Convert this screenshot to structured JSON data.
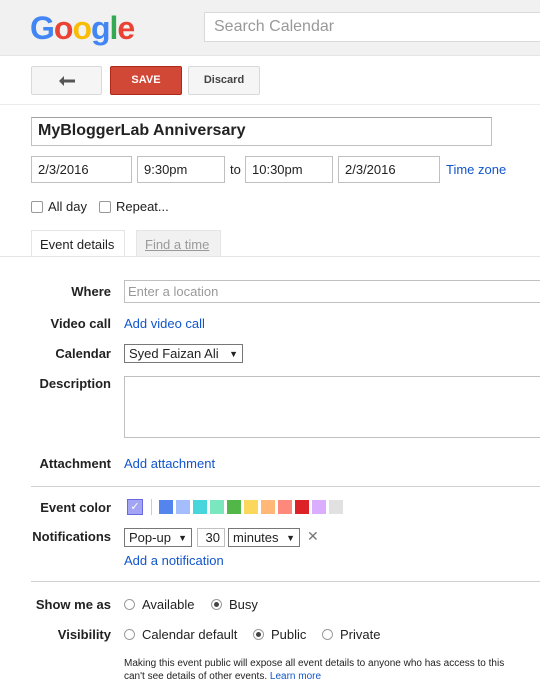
{
  "header": {
    "logo_letters": [
      {
        "ch": "G",
        "color": "#4285F4"
      },
      {
        "ch": "o",
        "color": "#EA4335"
      },
      {
        "ch": "o",
        "color": "#FBBC05"
      },
      {
        "ch": "g",
        "color": "#4285F4"
      },
      {
        "ch": "l",
        "color": "#34A853"
      },
      {
        "ch": "e",
        "color": "#EA4335"
      }
    ],
    "search_placeholder": "Search Calendar"
  },
  "toolbar": {
    "back_icon": "arrow-left-icon",
    "save_label": "SAVE",
    "discard_label": "Discard"
  },
  "event": {
    "title": "MyBloggerLab Anniversary",
    "start_date": "2/3/2016",
    "start_time": "9:30pm",
    "to_label": "to",
    "end_time": "10:30pm",
    "end_date": "2/3/2016",
    "time_zone_link": "Time zone",
    "all_day_label": "All day",
    "repeat_label": "Repeat..."
  },
  "tabs": [
    {
      "label": "Event details",
      "active": true
    },
    {
      "label": "Find a time",
      "active": false
    }
  ],
  "details": {
    "where_label": "Where",
    "where_placeholder": "Enter a location",
    "video_label": "Video call",
    "video_link": "Add video call",
    "calendar_label": "Calendar",
    "calendar_value": "Syed Faizan Ali",
    "description_label": "Description",
    "attachment_label": "Attachment",
    "attachment_link": "Add attachment",
    "event_color_label": "Event color",
    "colors": [
      "#a4a4f5",
      "#5484ed",
      "#a4bdfc",
      "#46d6db",
      "#7ae7bf",
      "#51b749",
      "#fbd75b",
      "#ffb878",
      "#ff887c",
      "#dc2127",
      "#dbadff",
      "#e1e1e1"
    ],
    "notifications_label": "Notifications",
    "notification_type": "Pop-up",
    "notification_amount": "30",
    "notification_unit": "minutes",
    "remove_icon": "close-icon",
    "add_notification_link": "Add a notification",
    "show_me_as_label": "Show me as",
    "show_available": "Available",
    "show_busy": "Busy",
    "show_selected": "Busy",
    "visibility_label": "Visibility",
    "vis_default": "Calendar default",
    "vis_public": "Public",
    "vis_private": "Private",
    "vis_selected": "Public",
    "public_note_line1": "Making this event public will expose all event details to anyone who has access to this",
    "public_note_line2": "can't see details of other events.",
    "learn_more": "Learn more"
  }
}
